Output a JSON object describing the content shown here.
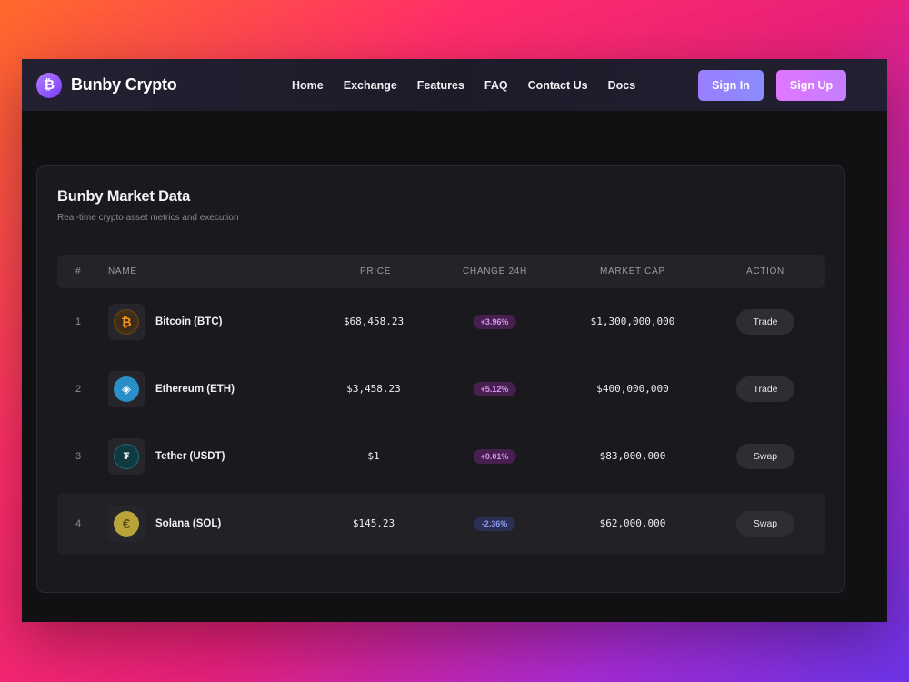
{
  "brand": {
    "name": "Bunby Crypto",
    "logo_icon": "bitcoin-icon"
  },
  "nav": {
    "items": [
      "Home",
      "Exchange",
      "Features",
      "FAQ",
      "Contact Us",
      "Docs"
    ]
  },
  "auth": {
    "sign_in": "Sign In",
    "sign_up": "Sign Up"
  },
  "market": {
    "title": "Bunby Market Data",
    "subtitle": "Real-time crypto asset metrics and execution",
    "columns": [
      "#",
      "NAME",
      "PRICE",
      "CHANGE 24H",
      "MARKET CAP",
      "ACTION"
    ],
    "rows": [
      {
        "rank": "1",
        "icon": "bitcoin-icon",
        "name": "Bitcoin (BTC)",
        "price": "$68,458.23",
        "change": "+3.96%",
        "change_dir": "up",
        "market_cap": "$1,300,000,000",
        "action": "Trade"
      },
      {
        "rank": "2",
        "icon": "ethereum-icon",
        "name": "Ethereum (ETH)",
        "price": "$3,458.23",
        "change": "+5.12%",
        "change_dir": "up",
        "market_cap": "$400,000,000",
        "action": "Trade"
      },
      {
        "rank": "3",
        "icon": "tether-icon",
        "name": "Tether (USDT)",
        "price": "$1",
        "change": "+0.01%",
        "change_dir": "up",
        "market_cap": "$83,000,000",
        "action": "Swap"
      },
      {
        "rank": "4",
        "icon": "solana-icon",
        "name": "Solana (SOL)",
        "price": "$145.23",
        "change": "-2.36%",
        "change_dir": "down",
        "market_cap": "$62,000,000",
        "action": "Swap"
      }
    ]
  },
  "colors": {
    "positive": "#d992f0",
    "negative": "#8c9af0",
    "accent": "#9a7dff"
  }
}
